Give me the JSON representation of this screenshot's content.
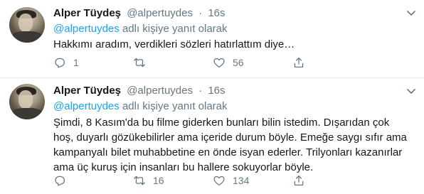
{
  "tweets": [
    {
      "author_name": "Alper Tüydeş",
      "author_handle": "@alpertuydes",
      "separator": "·",
      "time": "16s",
      "reply_mention": "@alpertuydes",
      "reply_suffix": " adlı kişiye yanıt olarak",
      "text": "Hakkımı aradım, verdikleri sözleri hatırlattım diye…",
      "reply_count": "1",
      "retweet_count": "",
      "like_count": "56"
    },
    {
      "author_name": "Alper Tüydeş",
      "author_handle": "@alpertuydes",
      "separator": "·",
      "time": "16s",
      "reply_mention": "@alpertuydes",
      "reply_suffix": " adlı kişiye yanıt olarak",
      "text": "Şimdi, 8 Kasım'da bu filme giderken bunları bilin istedim. Dışarıdan çok hoş, duyarlı gözükebilirler ama içeride durum böyle. Emeğe saygı sıfır ama kampanyalı bilet muhabbetine en önde isyan ederler. Trilyonları kazanırlar ama üç kuruş için insanları bu hallere sokuyorlar böyle.",
      "reply_count": "",
      "retweet_count": "16",
      "like_count": "134"
    }
  ],
  "icons": {
    "reply": "reply-icon",
    "retweet": "retweet-icon",
    "like": "heart-icon",
    "share": "share-icon",
    "more": "chevron-down-icon"
  },
  "colors": {
    "link": "#1da1f2",
    "muted": "#657786",
    "text": "#14171a",
    "divider": "#e6ecf0"
  }
}
